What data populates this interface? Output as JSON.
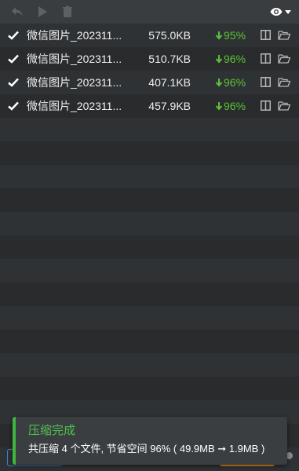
{
  "toolbar": {
    "undo_icon": "undo-icon",
    "play_icon": "play-icon",
    "trash_icon": "trash-icon",
    "view_icon": "eye-icon"
  },
  "files": [
    {
      "name": "微信图片_202311...",
      "size": "575.0KB",
      "saved": "95%"
    },
    {
      "name": "微信图片_202311...",
      "size": "510.7KB",
      "saved": "96%"
    },
    {
      "name": "微信图片_202311...",
      "size": "407.1KB",
      "saved": "96%"
    },
    {
      "name": "微信图片_202311...",
      "size": "457.9KB",
      "saved": "96%"
    }
  ],
  "toast": {
    "title": "压缩完成",
    "message": "共压缩 4 个文件, 节省空间 96% ( 49.9MB ➞ 1.9MB )"
  },
  "colors": {
    "accent_green": "#5bc236",
    "toast_bar": "#3fb53f",
    "primary_blue": "#3e7ed1",
    "warning_orange": "#e38a19"
  }
}
